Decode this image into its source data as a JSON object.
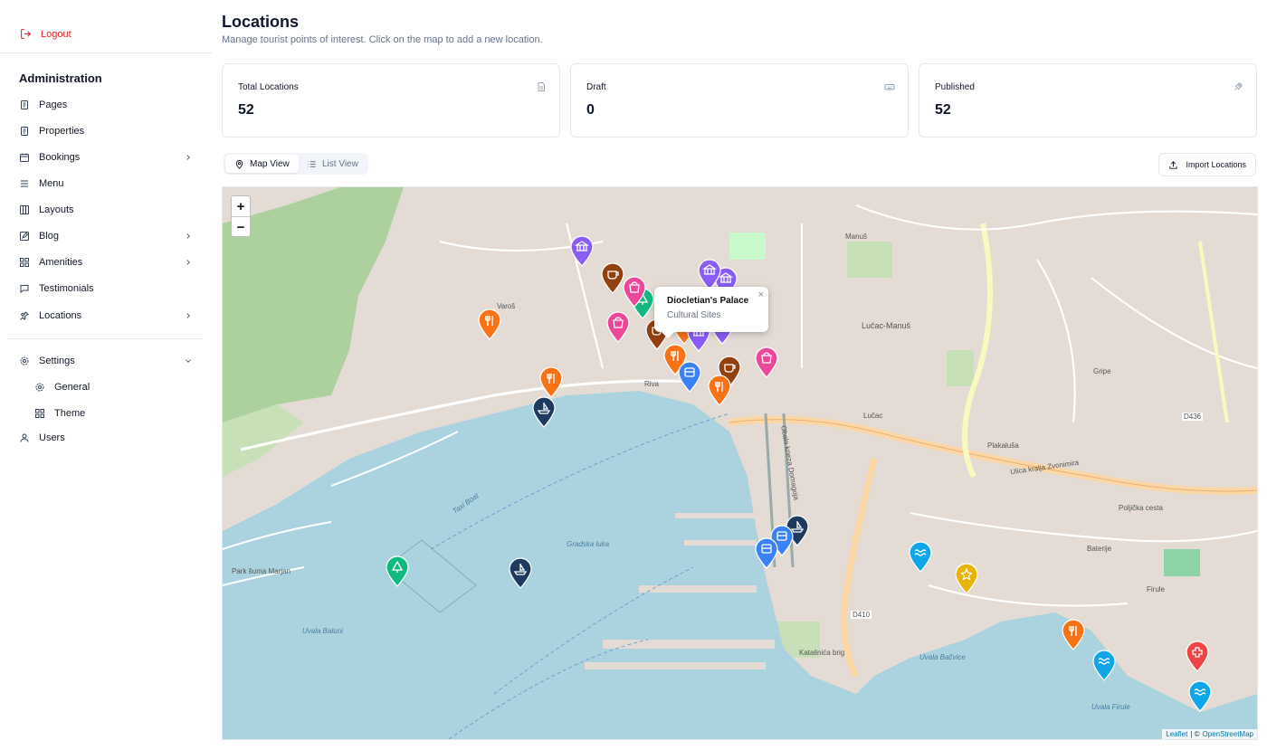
{
  "sidebar": {
    "logout_label": "Logout",
    "admin_title": "Administration",
    "items": [
      {
        "label": "Pages",
        "icon": "file-icon",
        "has_chevron": false
      },
      {
        "label": "Properties",
        "icon": "file-icon",
        "has_chevron": false
      },
      {
        "label": "Bookings",
        "icon": "calendar-icon",
        "has_chevron": true
      },
      {
        "label": "Menu",
        "icon": "menu-icon",
        "has_chevron": false
      },
      {
        "label": "Layouts",
        "icon": "columns-icon",
        "has_chevron": false
      },
      {
        "label": "Blog",
        "icon": "edit-icon",
        "has_chevron": true
      },
      {
        "label": "Amenities",
        "icon": "grid-icon",
        "has_chevron": true
      },
      {
        "label": "Testimonials",
        "icon": "message-icon",
        "has_chevron": false
      },
      {
        "label": "Locations",
        "icon": "pin-icon",
        "has_chevron": true
      }
    ],
    "settings_label": "Settings",
    "settings_children": [
      {
        "label": "General",
        "icon": "gear-icon"
      },
      {
        "label": "Theme",
        "icon": "grid-icon"
      }
    ],
    "users_label": "Users"
  },
  "header": {
    "title": "Locations",
    "subtitle": "Manage tourist points of interest. Click on the map to add a new location."
  },
  "stats": [
    {
      "label": "Total Locations",
      "value": "52",
      "icon": "document-icon"
    },
    {
      "label": "Draft",
      "value": "0",
      "icon": "keyboard-icon"
    },
    {
      "label": "Published",
      "value": "52",
      "icon": "rocket-icon"
    }
  ],
  "view_tabs": {
    "map_label": "Map View",
    "list_label": "List View",
    "active": "map"
  },
  "import_label": "Import Locations",
  "map": {
    "zoom_in": "+",
    "zoom_out": "−",
    "attribution_leaflet": "Leaflet",
    "attribution_sep": "| ©",
    "attribution_osm": "OpenStreetMap",
    "popup": {
      "title": "Diocletian's Palace",
      "subtitle": "Cultural Sites",
      "close": "×"
    },
    "labels": {
      "varos": "Varoš",
      "riva": "Riva",
      "manus": "Manuš",
      "lucac_manus": "Lučac-Manuš",
      "lucac": "Lučac",
      "gripe": "Gripe",
      "plakaluša": "Plakaluša",
      "firule": "Firule",
      "baterije": "Baterije",
      "gradska_luka": "Gradska luka",
      "uvala_baluni": "Uvala Baluni",
      "uvala_bacvice": "Uvala Bačvice",
      "uvala_firule": "Uvala Firule",
      "katalinica_brig": "Katalinića brig",
      "zvonimir": "Ulica kralja Zvonimira",
      "pojiska": "Poljička cesta",
      "obala": "Obala kneza Domagoja",
      "d410": "D410",
      "d436": "D436",
      "taxi_boat": "Taxi Boat",
      "park_marjan": "Park šuma Marjan"
    }
  },
  "marker_colors": {
    "restaurant": "#f97316",
    "culture": "#8b5cf6",
    "cafe": "#92400e",
    "shopping": "#ec4899",
    "nature": "#10b981",
    "boat": "#1e3a5f",
    "bus": "#3b82f6",
    "beach": "#0ea5e9",
    "nightlife": "#eab308",
    "health": "#ef4444"
  }
}
